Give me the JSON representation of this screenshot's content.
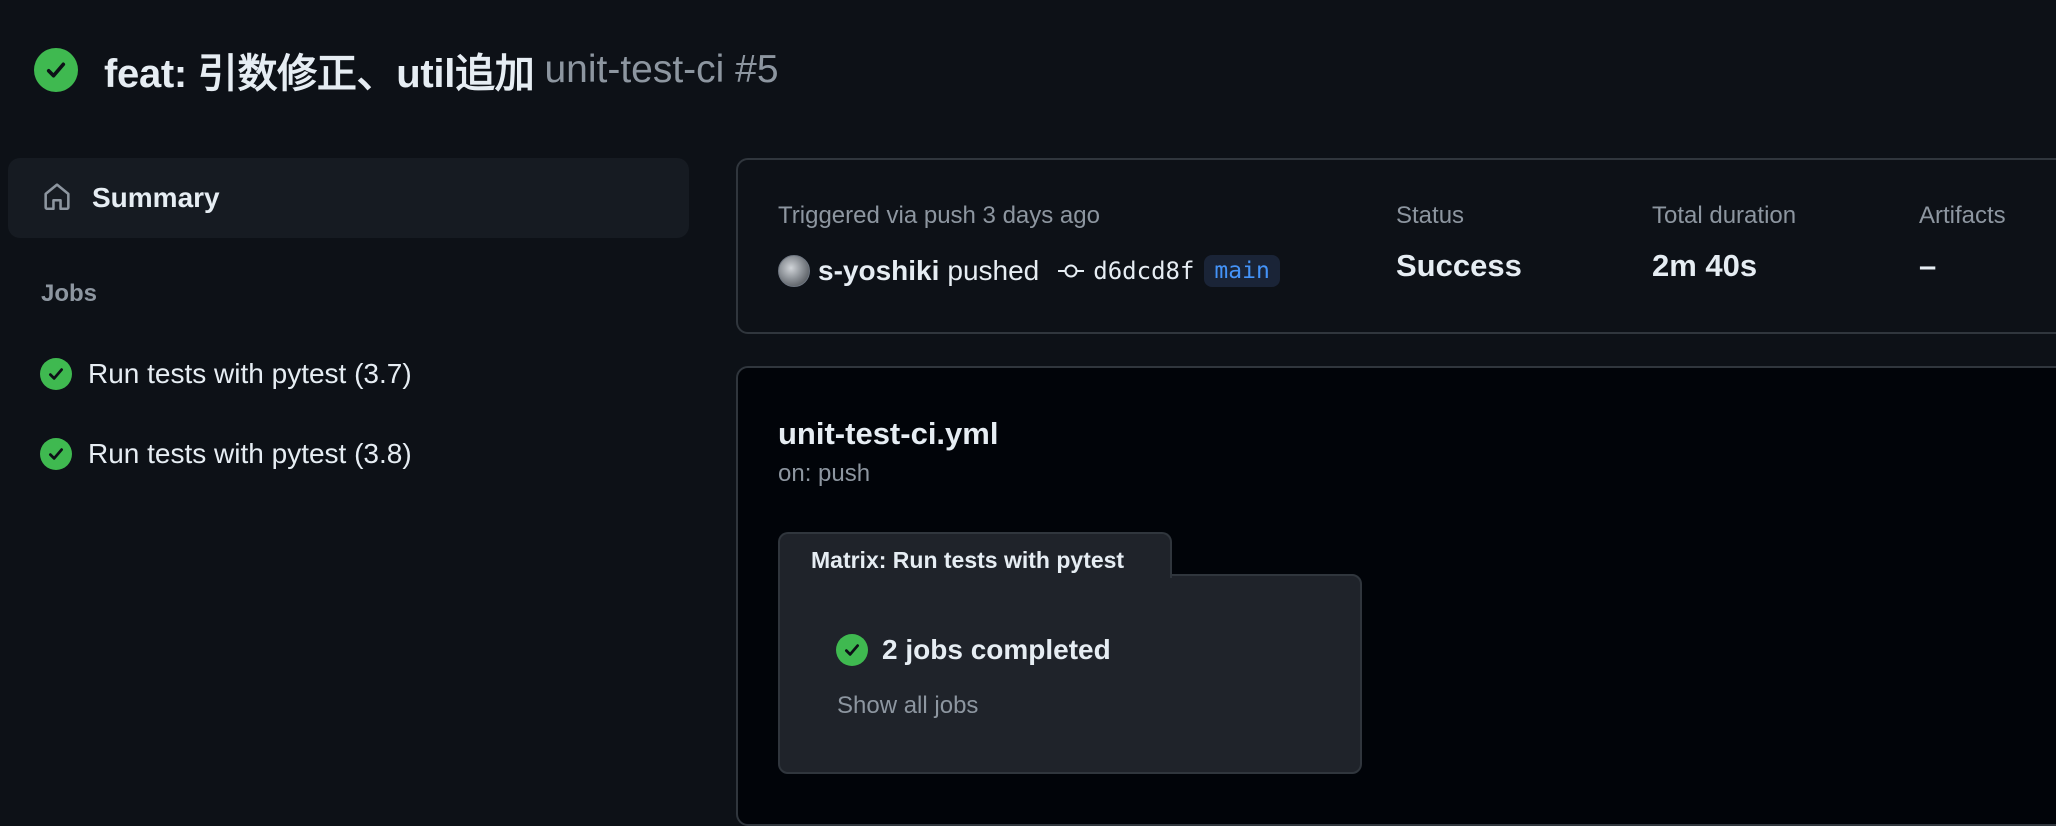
{
  "run": {
    "commit_message": "feat: 引数修正、util追加",
    "workflow_run": "unit-test-ci #5",
    "status_icon": "check-circle-icon",
    "status_color": "#3fb950"
  },
  "sidebar": {
    "summary_label": "Summary",
    "summary_icon": "home-icon",
    "jobs_heading": "Jobs",
    "jobs": [
      {
        "label": "Run tests with pytest (3.7)",
        "icon": "check-circle-icon"
      },
      {
        "label": "Run tests with pytest (3.8)",
        "icon": "check-circle-icon"
      }
    ]
  },
  "summary_card": {
    "triggered": "Triggered via push 3 days ago",
    "pusher": "s-yoshiki",
    "action": "pushed",
    "commit_sha": "d6dcd8f",
    "branch": "main",
    "status_label": "Status",
    "status_value": "Success",
    "duration_label": "Total duration",
    "duration_value": "2m 40s",
    "artifacts_label": "Artifacts",
    "artifacts_value": "–"
  },
  "workflow_graph": {
    "file": "unit-test-ci.yml",
    "trigger": "on: push",
    "matrix_title": "Matrix: Run tests with pytest",
    "matrix_summary": "2 jobs completed",
    "show_all": "Show all jobs"
  },
  "colors": {
    "background": "#0d1117",
    "success": "#3fb950",
    "link": "#4493f8",
    "muted": "#8d96a0",
    "border": "#30363d"
  }
}
